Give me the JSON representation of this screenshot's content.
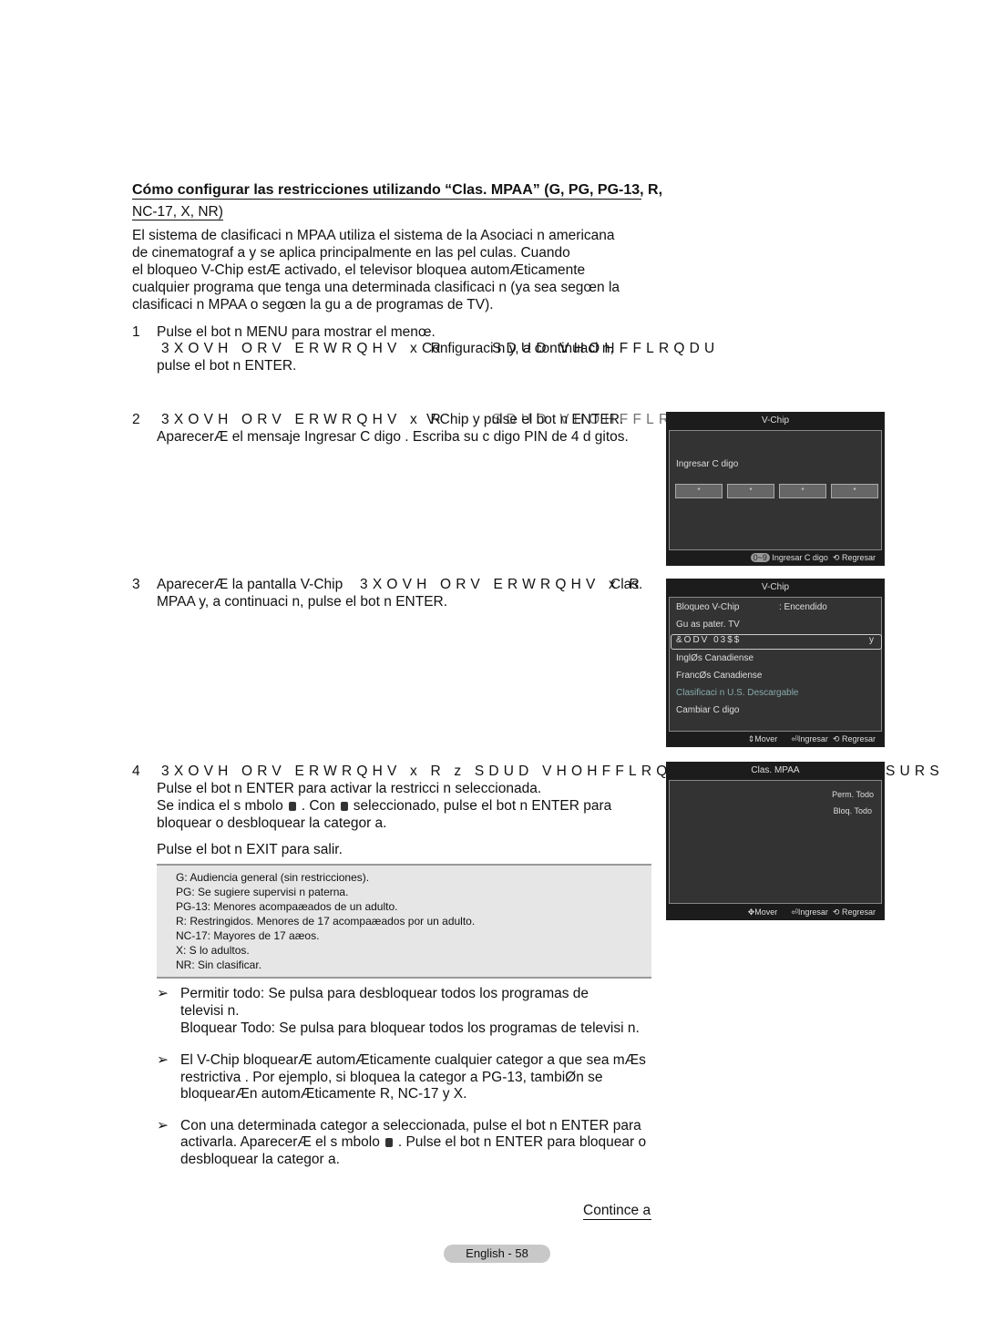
{
  "heading": {
    "line1": "Cómo configurar las restricciones utilizando “Clas. MPAA” (G, PG, PG-13, R,",
    "line2": "NC-17, X, NR)"
  },
  "intro": [
    "El sistema de clasificaci n MPAA utiliza el sistema de la Asociaci n americana",
    "de cinematograf a y se aplica principalmente en las pel culas. Cuando",
    "el bloqueo V-Chip estÆ activado, el televisor bloquea automÆticamente",
    "cualquier programa que tenga una determinada clasificaci n (ya sea segœn la",
    "clasificaci n MPAA o segœn la gu a de programas de TV)."
  ],
  "steps": [
    {
      "num": "1",
      "lines": [
        "Pulse el bot n  MENU para mostrar el menœ.",
        "3XOVH ORV ERWRQHV x R",
        "Configuraci n y, a continuaci n,",
        "SDUD VHOHFFLRQDU",
        "pulse el bot n  ENTER."
      ]
    },
    {
      "num": "2",
      "lines": [
        "3XOVH ORV ERWRQHV x R",
        "V-Chip y pulse el bot n ENTER.",
        "SDUD VHOHFFLRQDU",
        "AparecerÆ el mensaje",
        "Ingresar C digo",
        "  . Escriba su c digo PIN de 4 d gitos."
      ]
    },
    {
      "num": "3",
      "lines": [
        "AparecerÆ la pantalla",
        "V-Chip",
        "3XOVH ORV ERWRQHV x R",
        "Clas.",
        "SDUD VHOHFFLRQDU",
        "MPAA y, a continuaci n, pulse el bot n  ENTER."
      ]
    },
    {
      "num": "4",
      "lines": [
        "3XOVH ORV ERWRQHV x R z SDUD VHOHFFLRQDU",
        "SURS",
        "Pulse el bot n  ENTER para activar la restricci n seleccionada.",
        "Se indica el s mbolo",
        ". Con",
        "seleccionado, pulse el bot n  ENTER para",
        "bloquear o desbloquear la categor a.",
        "Pulse el bot n  EXIT para salir."
      ]
    }
  ],
  "ratings": [
    "G: Audiencia general (sin restricciones).",
    "PG: Se sugiere supervisi n paterna.",
    "PG-13: Menores acompaæados de un adulto.",
    "R: Restringidos. Menores de 17 acompaæados por un adulto.",
    "NC-17: Mayores de 17 aæos.",
    "X: S lo adultos.",
    "NR: Sin clasificar."
  ],
  "notes": [
    [
      "Permitir todo:   Se pulsa para desbloquear todos los programas de",
      "televisi n.",
      "Bloquear Todo:   Se pulsa para bloquear todos los programas de televisi n."
    ],
    [
      "El V-Chip bloquearÆ automÆticamente cualquier categor a que sea mÆs",
      "restrictiva  . Por ejemplo, si bloquea la categor a PG-13, tambiØn se",
      "bloquearÆn automÆticamente R, NC-17 y X."
    ],
    [
      "Con una determinada categor a seleccionada, pulse el bot n  ENTER para",
      "activarla. AparecerÆ el s mbolo",
      ". Pulse el bot n  ENTER para bloquear o",
      "desbloquear la categor a."
    ]
  ],
  "note_arrow": "➢",
  "continue": "Contince a",
  "page_label": "English - 58",
  "screen1": {
    "title": "V-Chip",
    "label": "Ingresar C digo",
    "pins": [
      "*",
      "*",
      "*",
      "*"
    ],
    "footer": {
      "keys": "0~9",
      "enter": "Ingresar C digo",
      "back": "Regresar"
    }
  },
  "screen2": {
    "title": "V-Chip",
    "items": [
      "Bloqueo V-Chip",
      "Gu as pater. TV",
      "&ODV 03$$",
      "InglØs Canadiense",
      "FrancØs Canadiense",
      "Clasificaci n U.S. Descargable",
      "Cambiar C digo"
    ],
    "lock_value": ": Encendido",
    "selected_arrow": "y",
    "footer": {
      "move": "Mover",
      "enter": "Ingresar",
      "back": "Regresar"
    }
  },
  "screen3": {
    "title": "Clas. MPAA",
    "options": [
      "Perm. Todo",
      "Bloq. Todo"
    ],
    "footer": {
      "move": "Mover",
      "enter": "Ingresar",
      "back": "Regresar"
    }
  }
}
